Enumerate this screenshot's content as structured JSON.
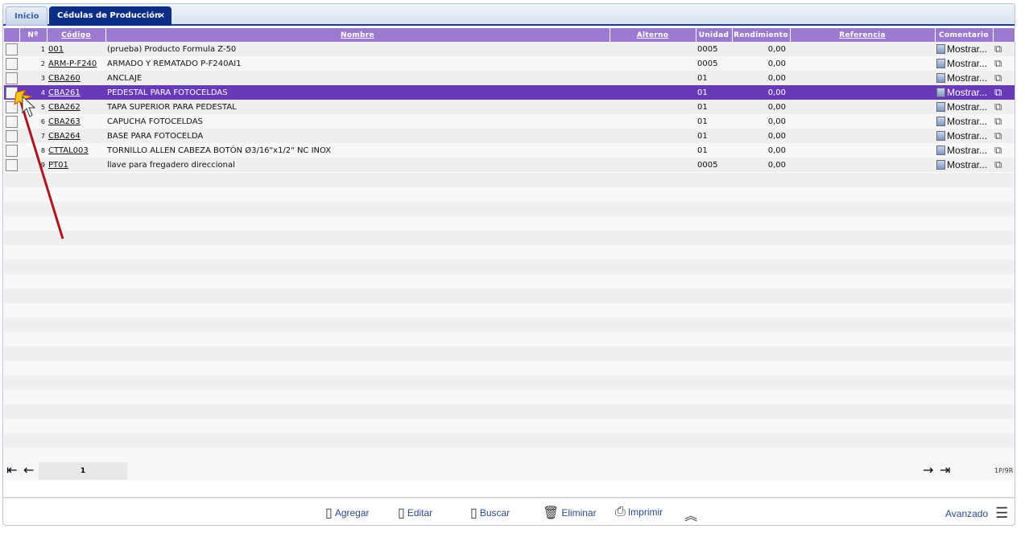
{
  "tabs": [
    {
      "label": "Inicio"
    },
    {
      "label": "Cédulas de Producción",
      "close": "×"
    }
  ],
  "columns": [
    "Nº",
    "Código",
    "Nombre",
    "Alterno",
    "Unidad",
    "Rendimiento",
    "Referencia",
    "Comentario"
  ],
  "rows": [
    {
      "n": "1",
      "codigo": "001",
      "nombre": "(prueba) Producto Formula Z-50",
      "alterno": "",
      "unidad": "0005",
      "rend": "0,00",
      "ref": "",
      "coment": "Mostrar..."
    },
    {
      "n": "2",
      "codigo": "ARM-P-F240",
      "nombre": "ARMADO Y REMATADO P-F240AI1",
      "alterno": "",
      "unidad": "0005",
      "rend": "0,00",
      "ref": "",
      "coment": "Mostrar..."
    },
    {
      "n": "3",
      "codigo": "CBA260",
      "nombre": "ANCLAJE",
      "alterno": "",
      "unidad": "01",
      "rend": "0,00",
      "ref": "",
      "coment": "Mostrar..."
    },
    {
      "n": "4",
      "codigo": "CBA261",
      "nombre": "PEDESTAL PARA FOTOCELDAS",
      "alterno": "",
      "unidad": "01",
      "rend": "0,00",
      "ref": "",
      "coment": "Mostrar...",
      "selected": true
    },
    {
      "n": "5",
      "codigo": "CBA262",
      "nombre": "TAPA SUPERIOR PARA PEDESTAL",
      "alterno": "",
      "unidad": "01",
      "rend": "0,00",
      "ref": "",
      "coment": "Mostrar..."
    },
    {
      "n": "6",
      "codigo": "CBA263",
      "nombre": "CAPUCHA FOTOCELDAS",
      "alterno": "",
      "unidad": "01",
      "rend": "0,00",
      "ref": "",
      "coment": "Mostrar..."
    },
    {
      "n": "7",
      "codigo": "CBA264",
      "nombre": "BASE PARA FOTOCELDA",
      "alterno": "",
      "unidad": "01",
      "rend": "0,00",
      "ref": "",
      "coment": "Mostrar..."
    },
    {
      "n": "8",
      "codigo": "CTTAL003",
      "nombre": "TORNILLO ALLEN CABEZA BOTÓN Ø3/16\"x1/2\" NC INOX",
      "alterno": "",
      "unidad": "01",
      "rend": "0,00",
      "ref": "",
      "coment": "Mostrar..."
    },
    {
      "n": "9",
      "codigo": "PT01",
      "nombre": "llave para fregadero direccional",
      "alterno": "",
      "unidad": "0005",
      "rend": "0,00",
      "ref": "",
      "coment": "Mostrar..."
    }
  ],
  "pager": {
    "page": "1",
    "summary": "1P/9R"
  },
  "toolbar": {
    "agregar": "Agregar",
    "editar": "Editar",
    "buscar": "Buscar",
    "eliminar": "Eliminar",
    "imprimir": "Imprimir",
    "avanzado": "Avanzado"
  },
  "colors": {
    "header": "#9a7bd0",
    "selected": "#673ab7",
    "tab_active": "#0e2e86"
  }
}
